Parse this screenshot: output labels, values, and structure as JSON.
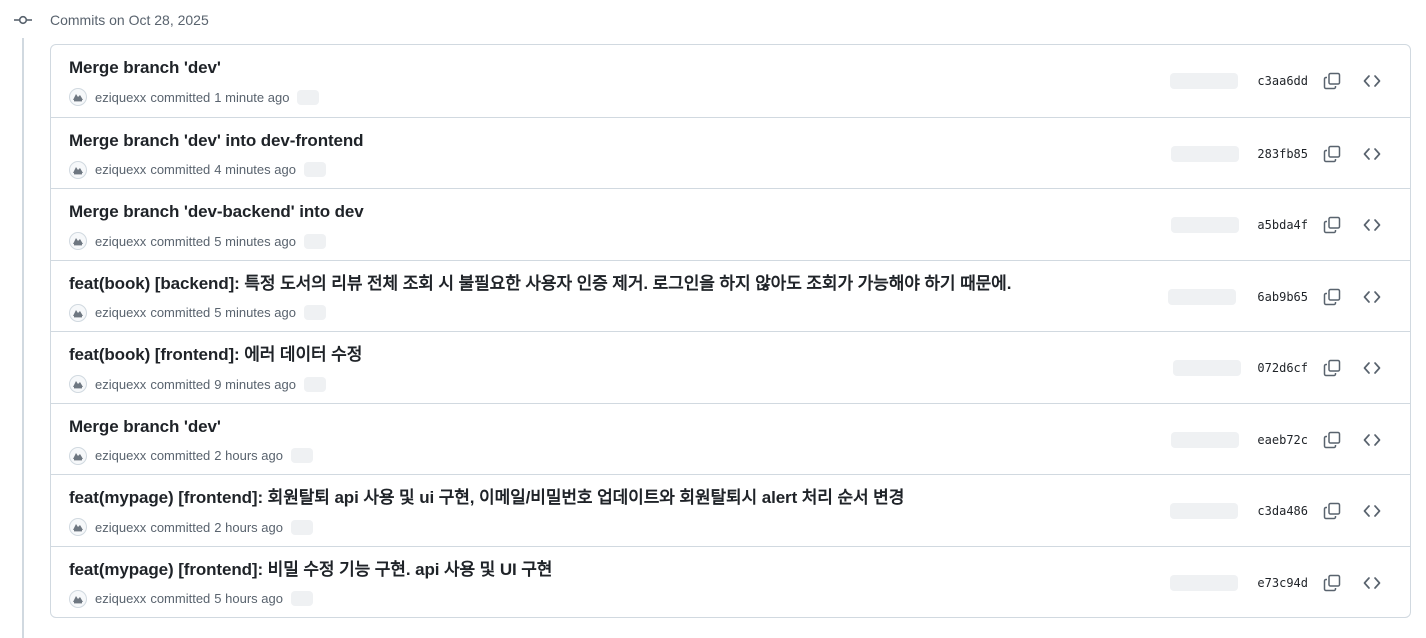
{
  "group": {
    "title": "Commits on Oct 28, 2025"
  },
  "commits": [
    {
      "title": "Merge branch 'dev'",
      "author": "eziquexx",
      "committed": "committed",
      "time": "1 minute ago",
      "sha": "c3aa6dd"
    },
    {
      "title": "Merge branch 'dev' into dev-frontend",
      "author": "eziquexx",
      "committed": "committed",
      "time": "4 minutes ago",
      "sha": "283fb85"
    },
    {
      "title": "Merge branch 'dev-backend' into dev",
      "author": "eziquexx",
      "committed": "committed",
      "time": "5 minutes ago",
      "sha": "a5bda4f"
    },
    {
      "title": "feat(book) [backend]: 특정 도서의 리뷰 전체 조회 시 불필요한 사용자 인증 제거. 로그인을 하지 않아도 조회가 가능해야 하기 때문에.",
      "author": "eziquexx",
      "committed": "committed",
      "time": "5 minutes ago",
      "sha": "6ab9b65"
    },
    {
      "title": "feat(book) [frontend]: 에러 데이터 수정",
      "author": "eziquexx",
      "committed": "committed",
      "time": "9 minutes ago",
      "sha": "072d6cf"
    },
    {
      "title": "Merge branch 'dev'",
      "author": "eziquexx",
      "committed": "committed",
      "time": "2 hours ago",
      "sha": "eaeb72c"
    },
    {
      "title": "feat(mypage) [frontend]: 회원탈퇴 api 사용 및 ui 구현, 이메일/비밀번호 업데이트와 회원탈퇴시 alert 처리 순서 변경",
      "author": "eziquexx",
      "committed": "committed",
      "time": "2 hours ago",
      "sha": "c3da486"
    },
    {
      "title": "feat(mypage) [frontend]: 비밀 수정 기능 구현. api 사용 및 UI 구현",
      "author": "eziquexx",
      "committed": "committed",
      "time": "5 hours ago",
      "sha": "e73c94d"
    }
  ],
  "icons": {
    "group": "git-commit-icon",
    "copy": "copy-icon",
    "browse": "code-icon",
    "avatar": "avatar-icon"
  },
  "colors": {
    "border": "#d1d9e0",
    "muted_text": "#59636e",
    "title_text": "#1f2328",
    "placeholder": "#eff1f3"
  }
}
